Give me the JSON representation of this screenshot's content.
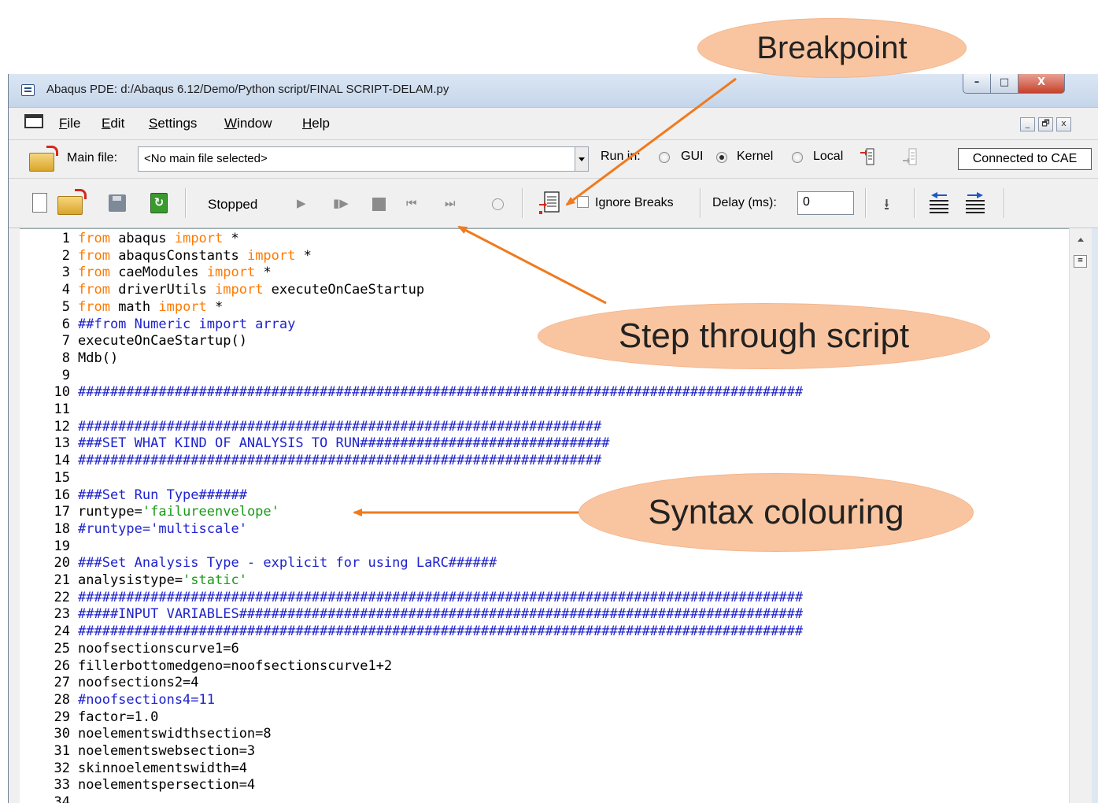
{
  "window": {
    "title": "Abaqus PDE: d:/Abaqus 6.12/Demo/Python script/FINAL SCRIPT-DELAM.py",
    "controls": {
      "minimize": "–",
      "maximize": "□",
      "close": "X"
    }
  },
  "menu": {
    "items": [
      "File",
      "Edit",
      "Settings",
      "Window",
      "Help"
    ],
    "mdi": {
      "minimize": "_",
      "restore": "🗗",
      "close": "x"
    }
  },
  "mainrow": {
    "main_file_label": "Main file:",
    "main_file_value": "<No main file selected>",
    "run_in_label": "Run in:",
    "run_options": [
      {
        "label": "GUI",
        "selected": false
      },
      {
        "label": "Kernel",
        "selected": true
      },
      {
        "label": "Local",
        "selected": false
      }
    ],
    "connection_status": "Connected to CAE"
  },
  "toolbar": {
    "status": "Stopped",
    "ignore_breaks_label": "Ignore Breaks",
    "ignore_breaks_checked": false,
    "delay_label": "Delay (ms):",
    "delay_value": "0"
  },
  "editor": {
    "lines": [
      [
        [
          "kw",
          "from"
        ],
        [
          "pl",
          " abaqus "
        ],
        [
          "kw",
          "import"
        ],
        [
          "pl",
          " *"
        ]
      ],
      [
        [
          "kw",
          "from"
        ],
        [
          "pl",
          " abaqusConstants "
        ],
        [
          "kw",
          "import"
        ],
        [
          "pl",
          " *"
        ]
      ],
      [
        [
          "kw",
          "from"
        ],
        [
          "pl",
          " caeModules "
        ],
        [
          "kw",
          "import"
        ],
        [
          "pl",
          " *"
        ]
      ],
      [
        [
          "kw",
          "from"
        ],
        [
          "pl",
          " driverUtils "
        ],
        [
          "kw",
          "import"
        ],
        [
          "pl",
          " executeOnCaeStartup"
        ]
      ],
      [
        [
          "kw",
          "from"
        ],
        [
          "pl",
          " math "
        ],
        [
          "kw",
          "import"
        ],
        [
          "pl",
          " *"
        ]
      ],
      [
        [
          "cm",
          "##from Numeric import array"
        ]
      ],
      [
        [
          "pl",
          "executeOnCaeStartup()"
        ]
      ],
      [
        [
          "pl",
          "Mdb()"
        ]
      ],
      [
        [
          "pl",
          ""
        ]
      ],
      [
        [
          "cm",
          "##########################################################################################"
        ]
      ],
      [
        [
          "pl",
          ""
        ]
      ],
      [
        [
          "cm",
          "#################################################################"
        ]
      ],
      [
        [
          "cm",
          "###SET WHAT KIND OF ANALYSIS TO RUN###############################"
        ]
      ],
      [
        [
          "cm",
          "#################################################################"
        ]
      ],
      [
        [
          "pl",
          ""
        ]
      ],
      [
        [
          "cm",
          "###Set Run Type######"
        ]
      ],
      [
        [
          "pl",
          "runtype="
        ],
        [
          "st",
          "'failureenvelope'"
        ]
      ],
      [
        [
          "cm",
          "#runtype='multiscale'"
        ]
      ],
      [
        [
          "pl",
          ""
        ]
      ],
      [
        [
          "cm",
          "###Set Analysis Type - explicit for using LaRC######"
        ]
      ],
      [
        [
          "pl",
          "analysistype="
        ],
        [
          "st",
          "'static'"
        ]
      ],
      [
        [
          "cm",
          "##########################################################################################"
        ]
      ],
      [
        [
          "cm",
          "#####INPUT VARIABLES######################################################################"
        ]
      ],
      [
        [
          "cm",
          "##########################################################################################"
        ]
      ],
      [
        [
          "pl",
          "noofsectionscurve1=6"
        ]
      ],
      [
        [
          "pl",
          "fillerbottomedgeno=noofsectionscurve1+2"
        ]
      ],
      [
        [
          "pl",
          "noofsections2=4"
        ]
      ],
      [
        [
          "cm",
          "#noofsections4=11"
        ]
      ],
      [
        [
          "pl",
          "factor=1.0"
        ]
      ],
      [
        [
          "pl",
          "noelementswidthsection=8"
        ]
      ],
      [
        [
          "pl",
          "noelementswebsection=3"
        ]
      ],
      [
        [
          "pl",
          "skinnoelementswidth=4"
        ]
      ],
      [
        [
          "pl",
          "noelementspersection=4"
        ]
      ],
      [
        [
          "pl",
          ""
        ]
      ]
    ]
  },
  "callouts": {
    "breakpoint": "Breakpoint",
    "step": "Step through script",
    "syntax": "Syntax colouring"
  },
  "colors": {
    "keyword": "#ff7a00",
    "comment": "#1f23cc",
    "string": "#1a9a1a",
    "callout": "#f9c5a0",
    "arrow": "#f07a1e"
  }
}
